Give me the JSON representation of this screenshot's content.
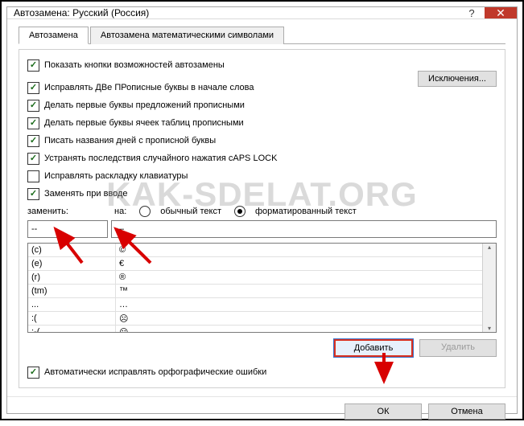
{
  "window": {
    "title": "Автозамена: Русский (Россия)",
    "help": "?",
    "close": "✕"
  },
  "tabs": {
    "t1": "Автозамена",
    "t2": "Автозамена математическими символами"
  },
  "checks": {
    "show_btn": "Показать кнопки возможностей автозамены",
    "two_caps": "Исправлять ДВе ПРописные буквы в начале слова",
    "first_sent": "Делать первые буквы предложений прописными",
    "first_cell": "Делать первые буквы ячеек таблиц прописными",
    "day_names": "Писать названия дней с прописной буквы",
    "caps_lock": "Устранять последствия случайного нажатия cAPS LOCK",
    "keyboard": "Исправлять раскладку клавиатуры",
    "replace_on": "Заменять при вводе",
    "auto_spell": "Автоматически исправлять орфографические ошибки"
  },
  "buttons": {
    "exceptions": "Исключения...",
    "add": "Добавить",
    "delete": "Удалить",
    "ok": "ОК",
    "cancel": "Отмена"
  },
  "replace": {
    "label_replace": "заменить:",
    "label_with": "на:",
    "opt_plain": "обычный текст",
    "opt_formatted": "форматированный текст",
    "input_left": "--",
    "input_right": "—"
  },
  "table": [
    {
      "k": "(c)",
      "v": "©"
    },
    {
      "k": "(e)",
      "v": "€"
    },
    {
      "k": "(r)",
      "v": "®"
    },
    {
      "k": "(tm)",
      "v": "™"
    },
    {
      "k": "...",
      "v": "…"
    },
    {
      "k": ":(",
      "v": "☹"
    },
    {
      "k": ":-(",
      "v": "☹"
    }
  ],
  "watermark": "KAK-SDELAT.ORG"
}
